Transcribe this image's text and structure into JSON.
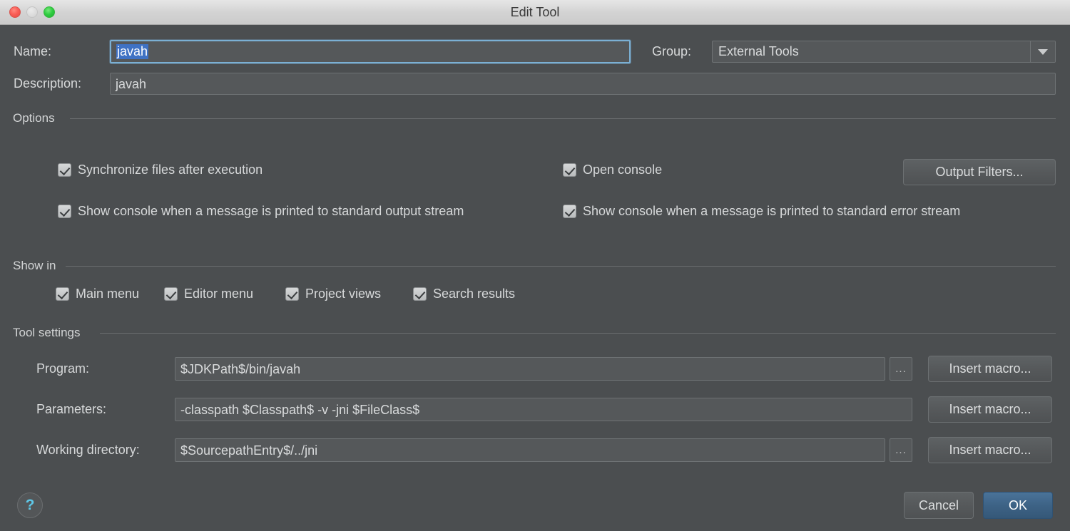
{
  "window": {
    "title": "Edit Tool",
    "traffic_lights": [
      "close",
      "minimize",
      "zoom"
    ]
  },
  "form": {
    "name_label": "Name:",
    "name_value": "javah",
    "group_label": "Group:",
    "group_value": "External Tools",
    "description_label": "Description:",
    "description_value": "javah"
  },
  "options": {
    "title": "Options",
    "items": [
      {
        "label": "Synchronize files after execution",
        "checked": true
      },
      {
        "label": "Open console",
        "checked": true
      },
      {
        "label": "Show console when a message is printed to standard output stream",
        "checked": true
      },
      {
        "label": "Show console when a message is printed to standard error stream",
        "checked": true
      }
    ],
    "output_filters_label": "Output Filters..."
  },
  "show_in": {
    "title": "Show in",
    "items": [
      {
        "label": "Main menu",
        "checked": true
      },
      {
        "label": "Editor menu",
        "checked": true
      },
      {
        "label": "Project views",
        "checked": true
      },
      {
        "label": "Search results",
        "checked": true
      }
    ]
  },
  "tool_settings": {
    "title": "Tool settings",
    "program_label": "Program:",
    "program_value": "$JDKPath$/bin/javah",
    "parameters_label": "Parameters:",
    "parameters_value": "-classpath $Classpath$ -v -jni $FileClass$",
    "working_directory_label": "Working directory:",
    "working_directory_value": "$SourcepathEntry$/../jni",
    "browse_label": "...",
    "insert_macro_label": "Insert macro..."
  },
  "footer": {
    "help_label": "?",
    "cancel_label": "Cancel",
    "ok_label": "OK"
  },
  "colors": {
    "dialog_bg": "#4b4e50",
    "field_bg": "#55585a",
    "accent_ok": "#3d6285",
    "selection": "#3f72c4",
    "help_glyph": "#5ec8e8"
  }
}
